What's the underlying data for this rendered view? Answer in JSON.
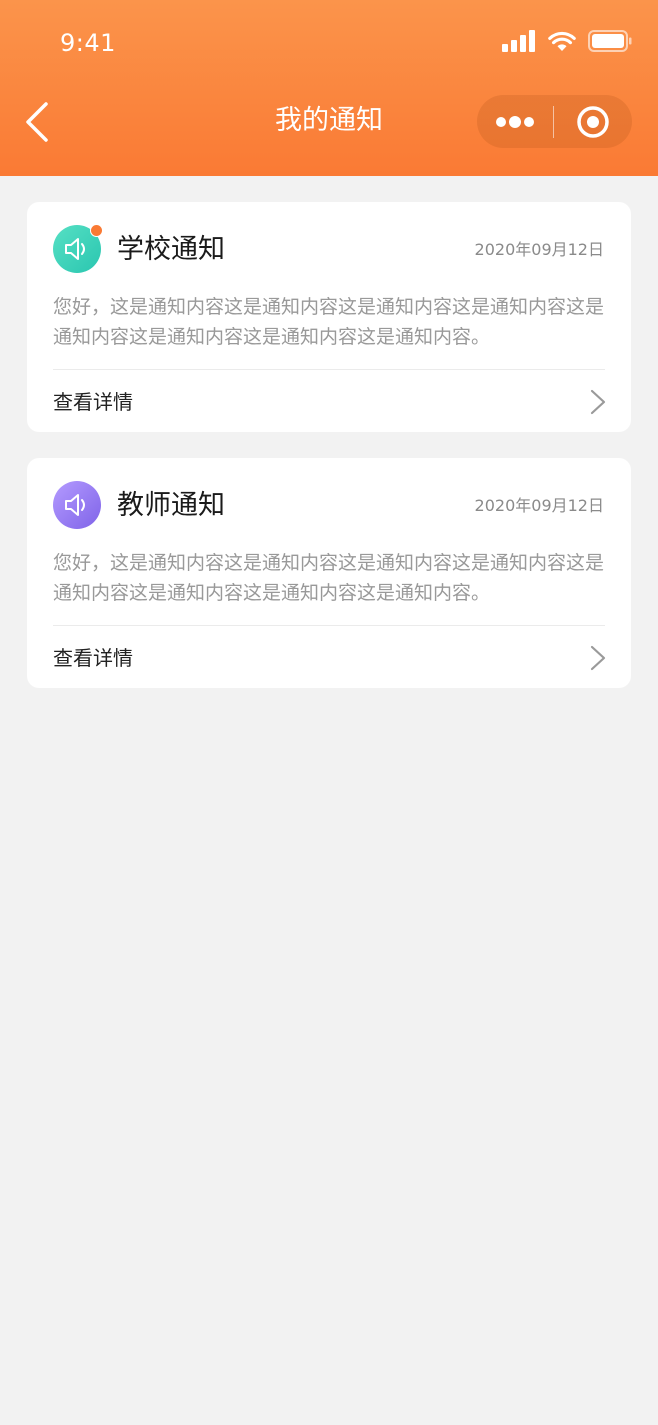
{
  "status_bar": {
    "time": "9:41"
  },
  "header": {
    "title": "我的通知",
    "back_icon": "chevron-left-icon",
    "more_icon": "more-dots-icon",
    "close_icon": "target-circle-icon"
  },
  "colors": {
    "header_gradient_top": "#fb944b",
    "header_gradient_bottom": "#fa7a34",
    "background": "#f2f2f2",
    "school_icon_gradient": [
      "#56e0c4",
      "#2ac6b0"
    ],
    "teacher_icon_gradient": [
      "#b49bff",
      "#7f63e8"
    ],
    "unread_dot": "#fa7a34"
  },
  "notifications": [
    {
      "title": "学校通知",
      "date": "2020年09月12日",
      "content": "您好，这是通知内容这是通知内容这是通知内容这是通知内容这是通知内容这是通知内容这是通知内容这是通知内容。",
      "detail_label": "查看详情",
      "icon": "speaker-icon",
      "unread": true
    },
    {
      "title": "教师通知",
      "date": "2020年09月12日",
      "content": "您好，这是通知内容这是通知内容这是通知内容这是通知内容这是通知内容这是通知内容这是通知内容这是通知内容。",
      "detail_label": "查看详情",
      "icon": "speaker-icon",
      "unread": false
    }
  ]
}
